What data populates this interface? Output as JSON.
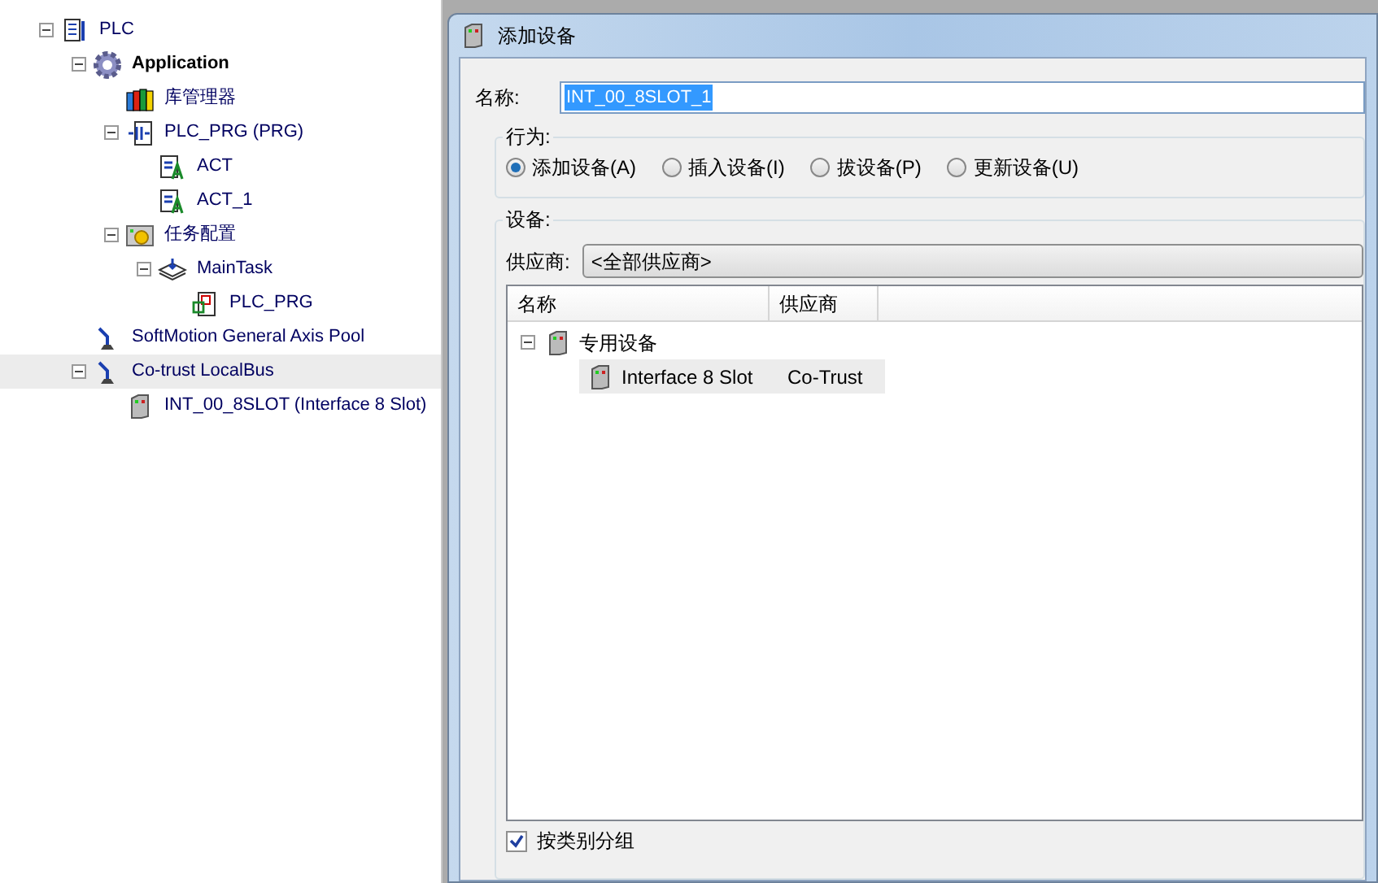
{
  "project_tree": [
    {
      "label": "PLC",
      "kind": "plc",
      "expanded": true,
      "selected": false,
      "children": [
        {
          "label": "Application",
          "kind": "application",
          "expanded": true,
          "selected": false,
          "children": [
            {
              "label": "库管理器",
              "kind": "library",
              "selected": false
            },
            {
              "label": "PLC_PRG (PRG)",
              "kind": "program",
              "expanded": true,
              "selected": false,
              "children": [
                {
                  "label": "ACT",
                  "kind": "action",
                  "selected": false
                },
                {
                  "label": "ACT_1",
                  "kind": "action",
                  "selected": false
                }
              ]
            },
            {
              "label": "任务配置",
              "kind": "taskconfig",
              "expanded": true,
              "selected": false,
              "children": [
                {
                  "label": "MainTask",
                  "kind": "task",
                  "expanded": true,
                  "selected": false,
                  "children": [
                    {
                      "label": "PLC_PRG",
                      "kind": "call",
                      "selected": false
                    }
                  ]
                }
              ]
            }
          ]
        },
        {
          "label": "SoftMotion General Axis Pool",
          "kind": "axis",
          "selected": false
        },
        {
          "label": "Co-trust LocalBus",
          "kind": "axis",
          "expanded": true,
          "selected": true,
          "children": [
            {
              "label": "INT_00_8SLOT (Interface 8 Slot)",
              "kind": "device",
              "selected": false
            }
          ]
        }
      ]
    }
  ],
  "dialog": {
    "title": "添加设备",
    "name_label": "名称:",
    "name_value": "INT_00_8SLOT_1",
    "action_group": "行为:",
    "actions": [
      {
        "label": "添加设备(A)",
        "selected": true
      },
      {
        "label": "插入设备(I)",
        "selected": false
      },
      {
        "label": "拔设备(P)",
        "selected": false
      },
      {
        "label": "更新设备(U)",
        "selected": false
      }
    ],
    "device_group": "设备:",
    "vendor_label": "供应商:",
    "vendor_value": "<全部供应商>",
    "columns": [
      "名称",
      "供应商"
    ],
    "device_tree": [
      {
        "name": "专用设备",
        "expanded": true,
        "children": [
          {
            "name": "Interface 8 Slot",
            "vendor": "Co-Trust",
            "selected": true
          }
        ]
      }
    ],
    "group_by_category": {
      "label": "按类别分组",
      "checked": true
    }
  }
}
